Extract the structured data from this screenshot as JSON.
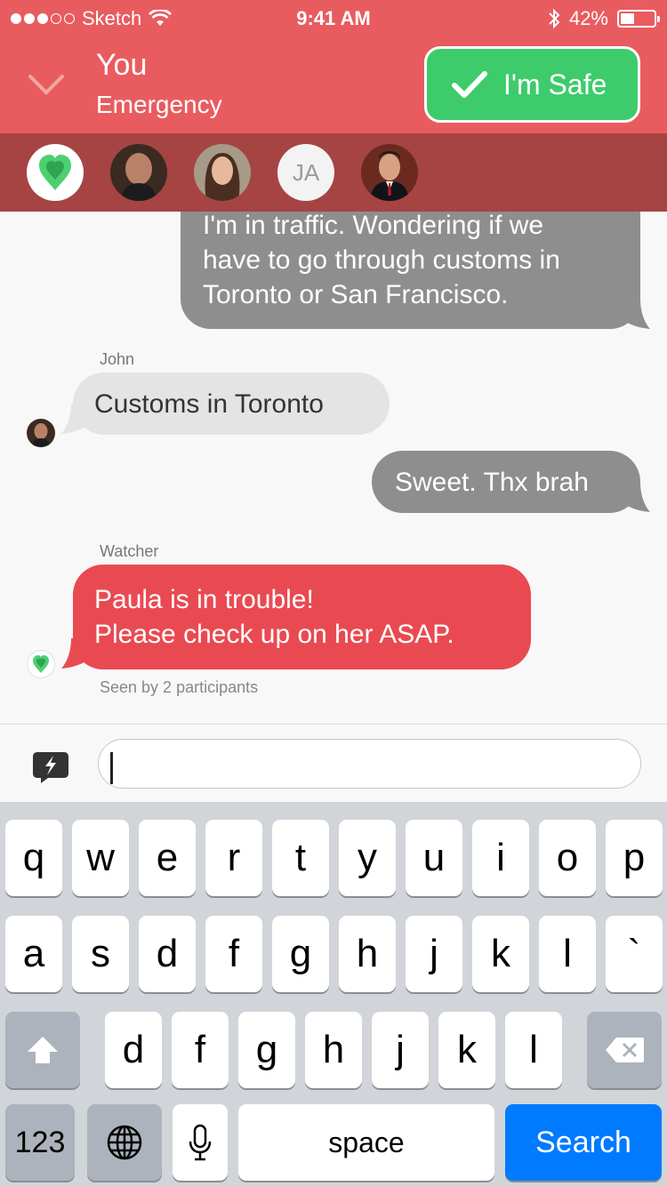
{
  "status_bar": {
    "carrier": "Sketch",
    "time": "9:41 AM",
    "battery_text": "42%",
    "battery_level": 0.42,
    "signal_bars_filled": 3,
    "signal_bars_total": 5
  },
  "header": {
    "title": "You",
    "subtitle": "Emergency",
    "safe_button_label": "I'm Safe",
    "background_color": "#e85c60",
    "participants_bar_color": "#a64444"
  },
  "participants": [
    {
      "type": "app-logo",
      "icon": "watcher-logo-icon"
    },
    {
      "type": "photo",
      "icon": "person-photo"
    },
    {
      "type": "photo",
      "icon": "person-photo"
    },
    {
      "type": "initials",
      "initials": "JA"
    },
    {
      "type": "photo",
      "icon": "person-photo"
    }
  ],
  "messages": [
    {
      "direction": "outgoing",
      "lines": [
        "I'm in traffic. Wondering if we",
        "have to go through customs in",
        "Toronto or San Francisco."
      ]
    },
    {
      "direction": "incoming",
      "sender": "John",
      "lines": [
        "Customs in Toronto"
      ]
    },
    {
      "direction": "outgoing",
      "lines": [
        "Sweet. Thx brah"
      ]
    },
    {
      "direction": "incoming",
      "sender": "Watcher",
      "alert": true,
      "lines": [
        "Paula is in trouble!",
        "Please check up on her ASAP."
      ]
    }
  ],
  "seen_text": "Seen by 2 participants",
  "input": {
    "value": "",
    "placeholder": ""
  },
  "keyboard": {
    "row1": [
      "q",
      "w",
      "e",
      "r",
      "t",
      "y",
      "u",
      "i",
      "o",
      "p"
    ],
    "row2": [
      "a",
      "s",
      "d",
      "f",
      "g",
      "h",
      "j",
      "k",
      "l",
      "`"
    ],
    "row3": [
      "d",
      "f",
      "g",
      "h",
      "j",
      "k",
      "l"
    ],
    "numbers_label": "123",
    "space_label": "space",
    "search_label": "Search",
    "accent_color": "#007aff"
  },
  "colors": {
    "safe_green": "#3ecb6b",
    "alert_red": "#e94a52",
    "outgoing_gray": "#8e8e8e",
    "incoming_gray": "#e4e4e4"
  }
}
